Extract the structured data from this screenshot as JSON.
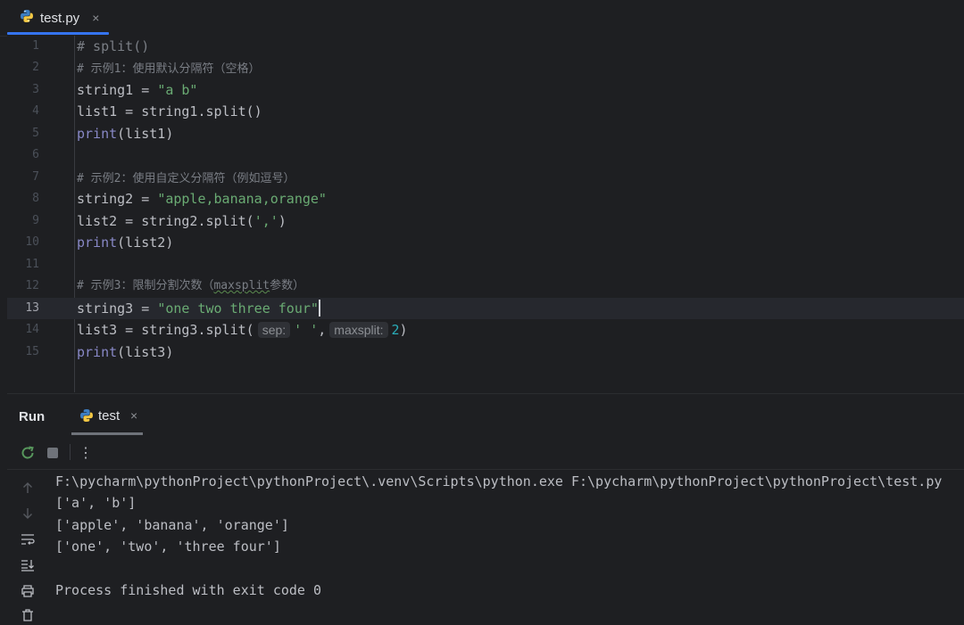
{
  "tabs": {
    "file_tab_label": "test.py",
    "close_glyph": "×"
  },
  "editor": {
    "line_numbers": [
      "1",
      "2",
      "3",
      "4",
      "5",
      "6",
      "7",
      "8",
      "9",
      "10",
      "11",
      "12",
      "13",
      "14",
      "15"
    ],
    "current_line": "13",
    "lines": {
      "l1": "# split()",
      "l2": "# 示例1：使用默认分隔符（空格）",
      "l3_var": "string1 = ",
      "l3_str": "\"a b\"",
      "l4": "list1 = string1.split()",
      "l5_fn": "print",
      "l5_rest": "(list1)",
      "l7": "# 示例2：使用自定义分隔符（例如逗号）",
      "l8_var": "string2 = ",
      "l8_str": "\"apple,banana,orange\"",
      "l9_pre": "list2 = string2.split(",
      "l9_str": "','",
      "l9_post": ")",
      "l10_fn": "print",
      "l10_rest": "(list2)",
      "l12_pre": "# 示例3：限制分割次数（",
      "l12_word": "maxsplit",
      "l12_post": "参数）",
      "l13_var": "string3 = ",
      "l13_str": "\"one two three four\"",
      "l14_pre": "list3 = string3.split(",
      "l14_hint1": "sep:",
      "l14_str": "' '",
      "l14_comma": ",",
      "l14_hint2": "maxsplit:",
      "l14_num": "2",
      "l14_post": ")",
      "l15_fn": "print",
      "l15_rest": "(list3)"
    }
  },
  "run_panel": {
    "title": "Run",
    "tab_label": "test",
    "close_glyph": "×",
    "more_glyph": "⋮"
  },
  "console": {
    "lines": [
      "F:\\pycharm\\pythonProject\\pythonProject\\.venv\\Scripts\\python.exe F:\\pycharm\\pythonProject\\pythonProject\\test.py",
      "['a', 'b']",
      "['apple', 'banana', 'orange']",
      "['one', 'two', 'three four']",
      "",
      "Process finished with exit code 0"
    ]
  },
  "icons": {
    "python": "python-icon",
    "rerun": "rerun-icon",
    "stop": "stop-icon",
    "up": "arrow-up-icon",
    "down": "arrow-down-icon",
    "wrap": "soft-wrap-icon",
    "scroll": "scroll-to-end-icon",
    "print": "print-icon",
    "trash": "trash-icon"
  },
  "colors": {
    "accent": "#3574f0",
    "string": "#6aab73",
    "keyword": "#8888c6",
    "number": "#2aacb8",
    "comment": "#7a7e85",
    "text": "#bcbec4",
    "rerun": "#57965c"
  }
}
